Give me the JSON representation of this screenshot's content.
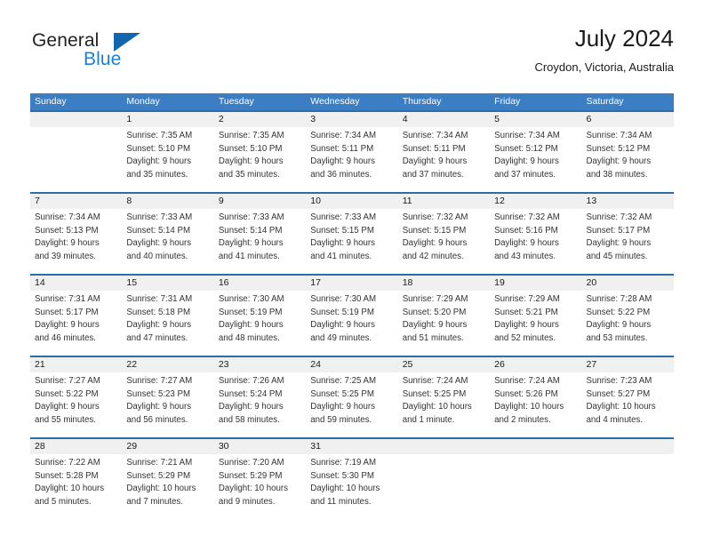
{
  "brand": {
    "name_top": "General",
    "name_bottom": "Blue",
    "color_dark": "#231f20",
    "color_blue": "#1c7fd4",
    "triangle_color": "#1366ab"
  },
  "header": {
    "title": "July 2024",
    "subtitle": "Croydon, Victoria, Australia"
  },
  "theme": {
    "header_bar": "#3b7ec4",
    "row_divider": "#2d6ca8",
    "daynum_band": "#f0f0f0",
    "text": "#333333"
  },
  "weekdays": [
    "Sunday",
    "Monday",
    "Tuesday",
    "Wednesday",
    "Thursday",
    "Friday",
    "Saturday"
  ],
  "weeks": [
    {
      "days": [
        {
          "num": "",
          "sunrise": "",
          "sunset": "",
          "daylight1": "",
          "daylight2": "",
          "empty": true
        },
        {
          "num": "1",
          "sunrise": "Sunrise: 7:35 AM",
          "sunset": "Sunset: 5:10 PM",
          "daylight1": "Daylight: 9 hours",
          "daylight2": "and 35 minutes.",
          "empty": false
        },
        {
          "num": "2",
          "sunrise": "Sunrise: 7:35 AM",
          "sunset": "Sunset: 5:10 PM",
          "daylight1": "Daylight: 9 hours",
          "daylight2": "and 35 minutes.",
          "empty": false
        },
        {
          "num": "3",
          "sunrise": "Sunrise: 7:34 AM",
          "sunset": "Sunset: 5:11 PM",
          "daylight1": "Daylight: 9 hours",
          "daylight2": "and 36 minutes.",
          "empty": false
        },
        {
          "num": "4",
          "sunrise": "Sunrise: 7:34 AM",
          "sunset": "Sunset: 5:11 PM",
          "daylight1": "Daylight: 9 hours",
          "daylight2": "and 37 minutes.",
          "empty": false
        },
        {
          "num": "5",
          "sunrise": "Sunrise: 7:34 AM",
          "sunset": "Sunset: 5:12 PM",
          "daylight1": "Daylight: 9 hours",
          "daylight2": "and 37 minutes.",
          "empty": false
        },
        {
          "num": "6",
          "sunrise": "Sunrise: 7:34 AM",
          "sunset": "Sunset: 5:12 PM",
          "daylight1": "Daylight: 9 hours",
          "daylight2": "and 38 minutes.",
          "empty": false
        }
      ]
    },
    {
      "days": [
        {
          "num": "7",
          "sunrise": "Sunrise: 7:34 AM",
          "sunset": "Sunset: 5:13 PM",
          "daylight1": "Daylight: 9 hours",
          "daylight2": "and 39 minutes.",
          "empty": false
        },
        {
          "num": "8",
          "sunrise": "Sunrise: 7:33 AM",
          "sunset": "Sunset: 5:14 PM",
          "daylight1": "Daylight: 9 hours",
          "daylight2": "and 40 minutes.",
          "empty": false
        },
        {
          "num": "9",
          "sunrise": "Sunrise: 7:33 AM",
          "sunset": "Sunset: 5:14 PM",
          "daylight1": "Daylight: 9 hours",
          "daylight2": "and 41 minutes.",
          "empty": false
        },
        {
          "num": "10",
          "sunrise": "Sunrise: 7:33 AM",
          "sunset": "Sunset: 5:15 PM",
          "daylight1": "Daylight: 9 hours",
          "daylight2": "and 41 minutes.",
          "empty": false
        },
        {
          "num": "11",
          "sunrise": "Sunrise: 7:32 AM",
          "sunset": "Sunset: 5:15 PM",
          "daylight1": "Daylight: 9 hours",
          "daylight2": "and 42 minutes.",
          "empty": false
        },
        {
          "num": "12",
          "sunrise": "Sunrise: 7:32 AM",
          "sunset": "Sunset: 5:16 PM",
          "daylight1": "Daylight: 9 hours",
          "daylight2": "and 43 minutes.",
          "empty": false
        },
        {
          "num": "13",
          "sunrise": "Sunrise: 7:32 AM",
          "sunset": "Sunset: 5:17 PM",
          "daylight1": "Daylight: 9 hours",
          "daylight2": "and 45 minutes.",
          "empty": false
        }
      ]
    },
    {
      "days": [
        {
          "num": "14",
          "sunrise": "Sunrise: 7:31 AM",
          "sunset": "Sunset: 5:17 PM",
          "daylight1": "Daylight: 9 hours",
          "daylight2": "and 46 minutes.",
          "empty": false
        },
        {
          "num": "15",
          "sunrise": "Sunrise: 7:31 AM",
          "sunset": "Sunset: 5:18 PM",
          "daylight1": "Daylight: 9 hours",
          "daylight2": "and 47 minutes.",
          "empty": false
        },
        {
          "num": "16",
          "sunrise": "Sunrise: 7:30 AM",
          "sunset": "Sunset: 5:19 PM",
          "daylight1": "Daylight: 9 hours",
          "daylight2": "and 48 minutes.",
          "empty": false
        },
        {
          "num": "17",
          "sunrise": "Sunrise: 7:30 AM",
          "sunset": "Sunset: 5:19 PM",
          "daylight1": "Daylight: 9 hours",
          "daylight2": "and 49 minutes.",
          "empty": false
        },
        {
          "num": "18",
          "sunrise": "Sunrise: 7:29 AM",
          "sunset": "Sunset: 5:20 PM",
          "daylight1": "Daylight: 9 hours",
          "daylight2": "and 51 minutes.",
          "empty": false
        },
        {
          "num": "19",
          "sunrise": "Sunrise: 7:29 AM",
          "sunset": "Sunset: 5:21 PM",
          "daylight1": "Daylight: 9 hours",
          "daylight2": "and 52 minutes.",
          "empty": false
        },
        {
          "num": "20",
          "sunrise": "Sunrise: 7:28 AM",
          "sunset": "Sunset: 5:22 PM",
          "daylight1": "Daylight: 9 hours",
          "daylight2": "and 53 minutes.",
          "empty": false
        }
      ]
    },
    {
      "days": [
        {
          "num": "21",
          "sunrise": "Sunrise: 7:27 AM",
          "sunset": "Sunset: 5:22 PM",
          "daylight1": "Daylight: 9 hours",
          "daylight2": "and 55 minutes.",
          "empty": false
        },
        {
          "num": "22",
          "sunrise": "Sunrise: 7:27 AM",
          "sunset": "Sunset: 5:23 PM",
          "daylight1": "Daylight: 9 hours",
          "daylight2": "and 56 minutes.",
          "empty": false
        },
        {
          "num": "23",
          "sunrise": "Sunrise: 7:26 AM",
          "sunset": "Sunset: 5:24 PM",
          "daylight1": "Daylight: 9 hours",
          "daylight2": "and 58 minutes.",
          "empty": false
        },
        {
          "num": "24",
          "sunrise": "Sunrise: 7:25 AM",
          "sunset": "Sunset: 5:25 PM",
          "daylight1": "Daylight: 9 hours",
          "daylight2": "and 59 minutes.",
          "empty": false
        },
        {
          "num": "25",
          "sunrise": "Sunrise: 7:24 AM",
          "sunset": "Sunset: 5:25 PM",
          "daylight1": "Daylight: 10 hours",
          "daylight2": "and 1 minute.",
          "empty": false
        },
        {
          "num": "26",
          "sunrise": "Sunrise: 7:24 AM",
          "sunset": "Sunset: 5:26 PM",
          "daylight1": "Daylight: 10 hours",
          "daylight2": "and 2 minutes.",
          "empty": false
        },
        {
          "num": "27",
          "sunrise": "Sunrise: 7:23 AM",
          "sunset": "Sunset: 5:27 PM",
          "daylight1": "Daylight: 10 hours",
          "daylight2": "and 4 minutes.",
          "empty": false
        }
      ]
    },
    {
      "days": [
        {
          "num": "28",
          "sunrise": "Sunrise: 7:22 AM",
          "sunset": "Sunset: 5:28 PM",
          "daylight1": "Daylight: 10 hours",
          "daylight2": "and 5 minutes.",
          "empty": false
        },
        {
          "num": "29",
          "sunrise": "Sunrise: 7:21 AM",
          "sunset": "Sunset: 5:29 PM",
          "daylight1": "Daylight: 10 hours",
          "daylight2": "and 7 minutes.",
          "empty": false
        },
        {
          "num": "30",
          "sunrise": "Sunrise: 7:20 AM",
          "sunset": "Sunset: 5:29 PM",
          "daylight1": "Daylight: 10 hours",
          "daylight2": "and 9 minutes.",
          "empty": false
        },
        {
          "num": "31",
          "sunrise": "Sunrise: 7:19 AM",
          "sunset": "Sunset: 5:30 PM",
          "daylight1": "Daylight: 10 hours",
          "daylight2": "and 11 minutes.",
          "empty": false
        },
        {
          "num": "",
          "sunrise": "",
          "sunset": "",
          "daylight1": "",
          "daylight2": "",
          "empty": true
        },
        {
          "num": "",
          "sunrise": "",
          "sunset": "",
          "daylight1": "",
          "daylight2": "",
          "empty": true
        },
        {
          "num": "",
          "sunrise": "",
          "sunset": "",
          "daylight1": "",
          "daylight2": "",
          "empty": true
        }
      ]
    }
  ]
}
